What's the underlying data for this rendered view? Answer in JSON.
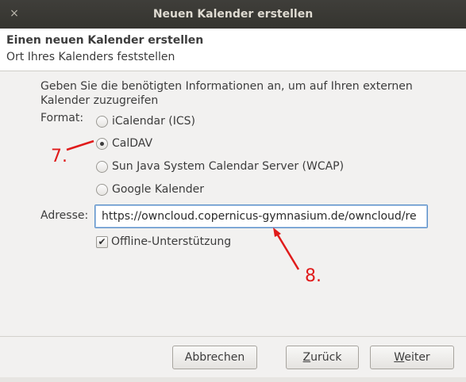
{
  "window": {
    "title": "Neuen Kalender erstellen",
    "close_glyph": "×"
  },
  "header": {
    "title": "Einen neuen Kalender erstellen",
    "subtitle": "Ort Ihres Kalenders feststellen"
  },
  "intro": "Geben Sie die benötigten Informationen an, um auf Ihren externen Kalender zuzugreifen",
  "format": {
    "label": "Format:",
    "selected": "CalDAV",
    "options": [
      {
        "label": "iCalendar (ICS)",
        "checked": false
      },
      {
        "label": "CalDAV",
        "checked": true
      },
      {
        "label": "Sun Java System Calendar Server (WCAP)",
        "checked": false
      },
      {
        "label": "Google Kalender",
        "checked": false
      }
    ]
  },
  "address": {
    "label": "Adresse:",
    "value": "https://owncloud.copernicus-gymnasium.de/owncloud/re"
  },
  "offline": {
    "label": "Offline-Unterstützung",
    "checked": true
  },
  "buttons": {
    "cancel": "Abbrechen",
    "back": "Zurück",
    "next": "Weiter"
  },
  "annotations": {
    "step7": "7.",
    "step8": "8.",
    "color": "#e01b1b"
  },
  "icons": {
    "close": "close-icon",
    "check": "checkmark-icon"
  }
}
